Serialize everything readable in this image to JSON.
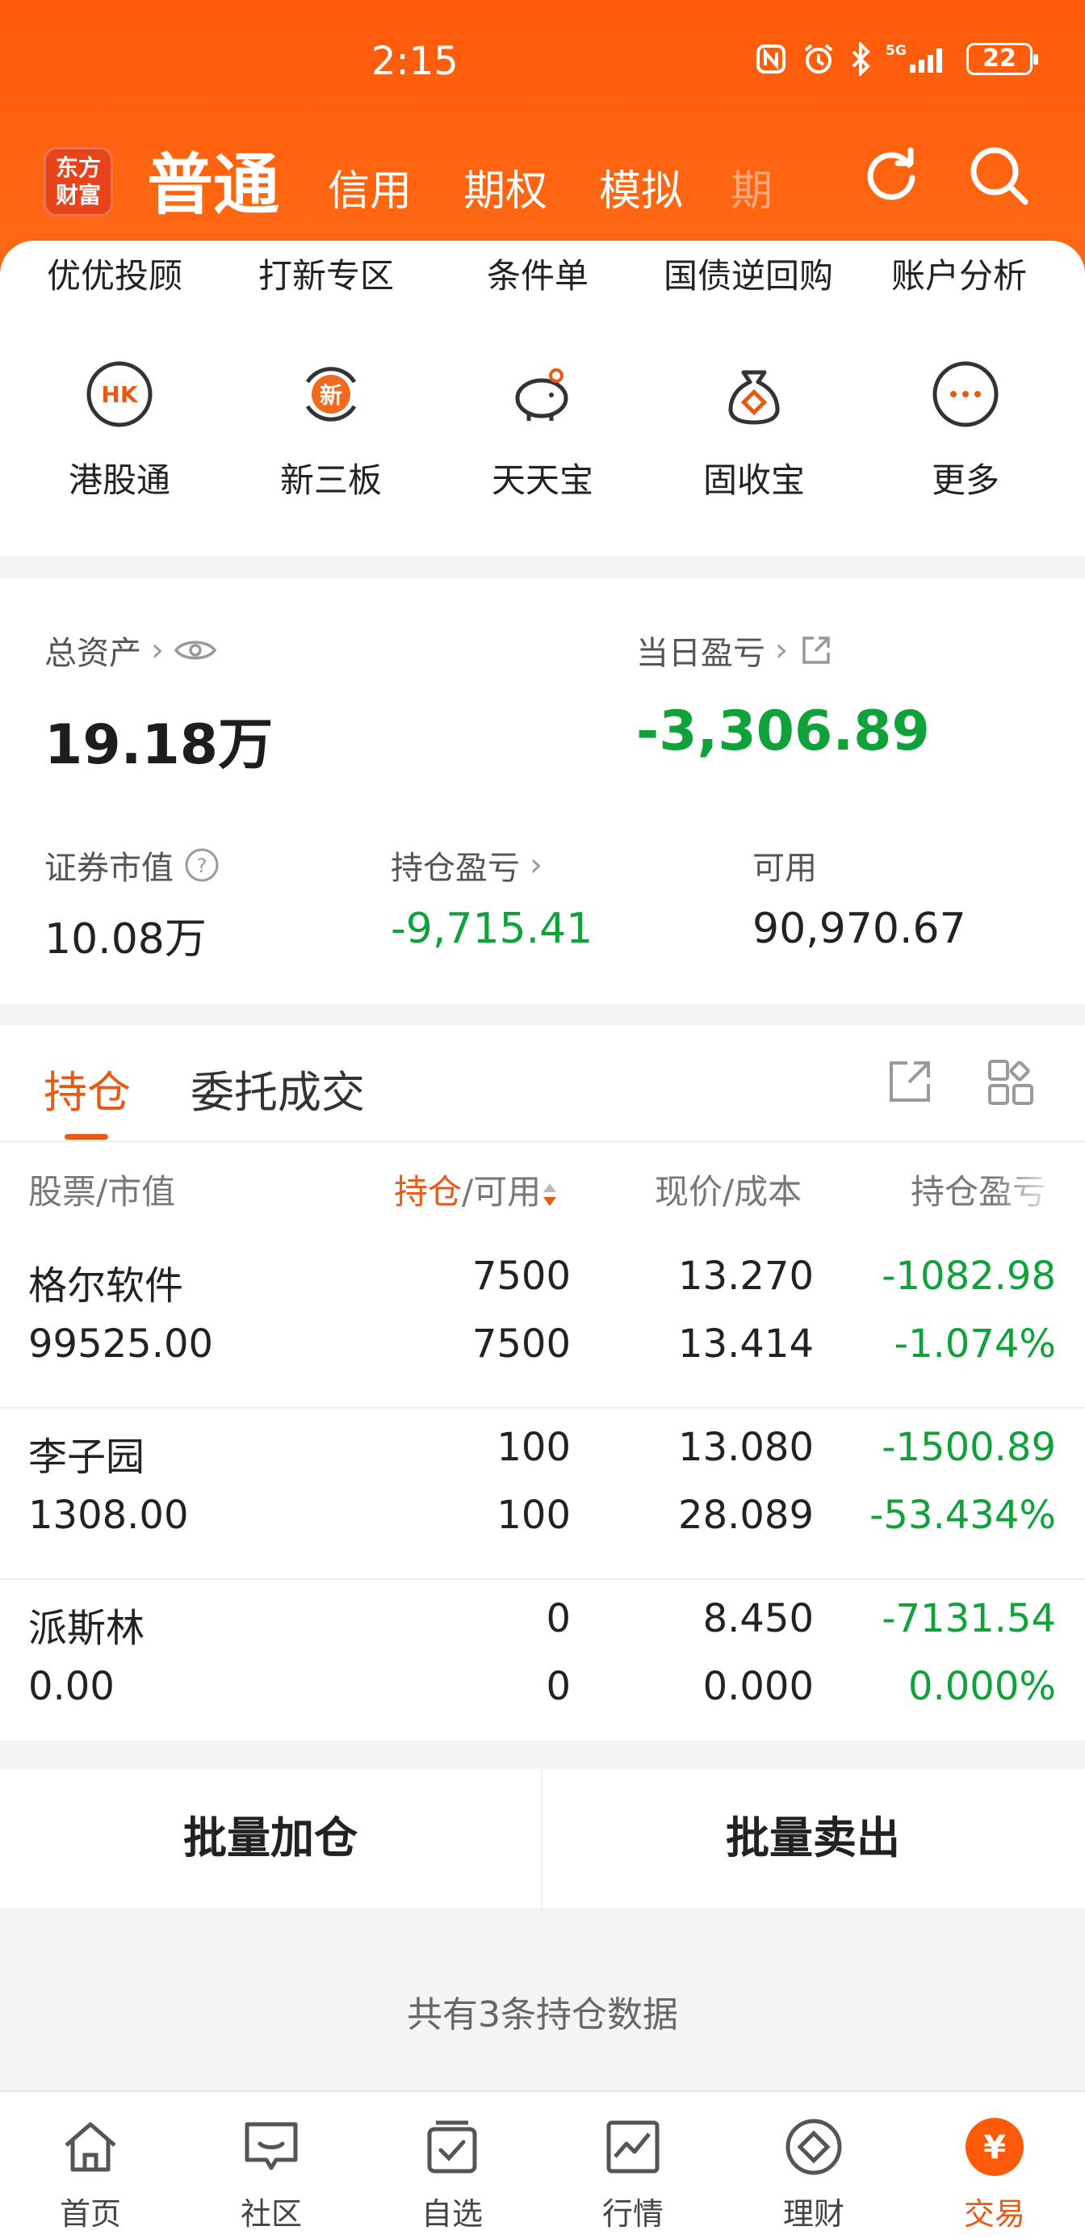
{
  "status_bar": {
    "time": "2:15",
    "battery": "22"
  },
  "header": {
    "logo_line1": "东方",
    "logo_line2": "财富",
    "tabs": [
      "普通",
      "信用",
      "期权",
      "模拟",
      "期"
    ]
  },
  "text_menu": [
    "优优投顾",
    "打新专区",
    "条件单",
    "国债逆回购",
    "账户分析"
  ],
  "icon_menu": [
    {
      "label": "港股通",
      "icon": "hk-icon",
      "badge": "HK"
    },
    {
      "label": "新三板",
      "icon": "new-board-icon",
      "badge": "新"
    },
    {
      "label": "天天宝",
      "icon": "piggy-bank-icon"
    },
    {
      "label": "固收宝",
      "icon": "money-bag-icon"
    },
    {
      "label": "更多",
      "icon": "more-icon"
    }
  ],
  "assets": {
    "total_label": "总资产",
    "total_value": "19.18万",
    "daily_label": "当日盈亏",
    "daily_value": "-3,306.89",
    "securities_label": "证券市值",
    "securities_value": "10.08万",
    "position_pl_label": "持仓盈亏",
    "position_pl_value": "-9,715.41",
    "available_label": "可用",
    "available_value": "90,970.67"
  },
  "positions": {
    "tabs": [
      "持仓",
      "委托成交"
    ],
    "columns": {
      "stock": "股票",
      "market_value": "/市值",
      "holding": "持仓",
      "available": "/可用",
      "price_cost": "现价/成本",
      "pl": "持仓盈亏"
    },
    "rows": [
      {
        "name": "格尔软件",
        "value": "99525.00",
        "hold": "7500",
        "avail": "7500",
        "price": "13.270",
        "cost": "13.414",
        "pl": "-1082.98",
        "pl_pct": "-1.074%"
      },
      {
        "name": "李子园",
        "value": "1308.00",
        "hold": "100",
        "avail": "100",
        "price": "13.080",
        "cost": "28.089",
        "pl": "-1500.89",
        "pl_pct": "-53.434%"
      },
      {
        "name": "派斯林",
        "value": "0.00",
        "hold": "0",
        "avail": "0",
        "price": "8.450",
        "cost": "0.000",
        "pl": "-7131.54",
        "pl_pct": "0.000%"
      }
    ]
  },
  "batch": {
    "add": "批量加仓",
    "sell": "批量卖出"
  },
  "summary": "共有3条持仓数据",
  "bottom_nav": [
    {
      "label": "首页",
      "icon": "home-icon"
    },
    {
      "label": "社区",
      "icon": "community-icon"
    },
    {
      "label": "自选",
      "icon": "watchlist-icon"
    },
    {
      "label": "行情",
      "icon": "market-icon"
    },
    {
      "label": "理财",
      "icon": "wealth-icon"
    },
    {
      "label": "交易",
      "icon": "trade-icon",
      "badge": "¥",
      "active": true
    }
  ],
  "colors": {
    "brand": "#ff5a0a",
    "accent": "#e85a14",
    "loss": "#10a13a"
  }
}
